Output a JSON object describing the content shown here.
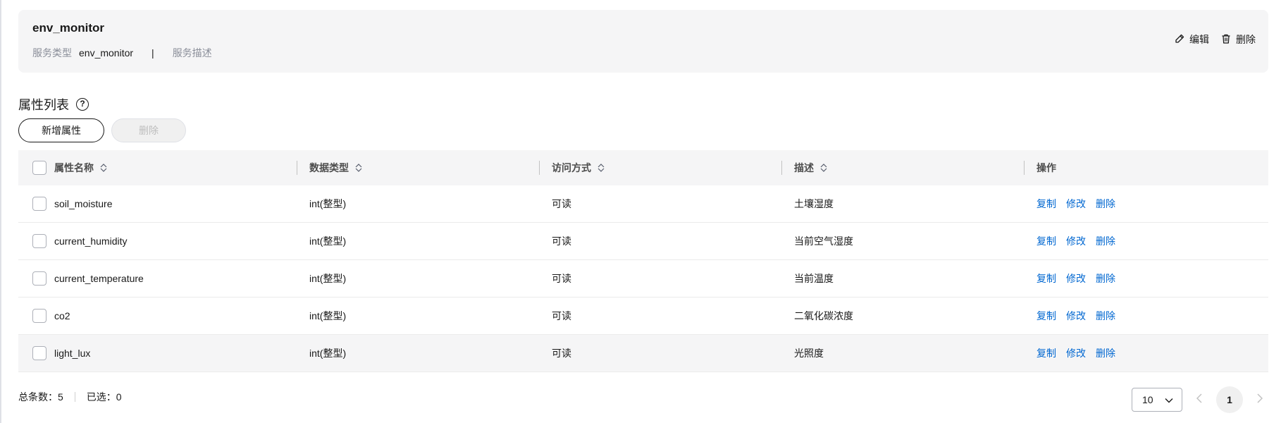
{
  "service": {
    "name": "env_monitor",
    "type_label": "服务类型",
    "type_value": "env_monitor",
    "separator": "|",
    "description_label": "服务描述",
    "edit_label": "编辑",
    "delete_label": "删除"
  },
  "section": {
    "title": "属性列表",
    "help_glyph": "?"
  },
  "toolbar": {
    "add_label": "新增属性",
    "delete_label": "删除"
  },
  "table": {
    "columns": [
      "属性名称",
      "数据类型",
      "访问方式",
      "描述",
      "操作"
    ],
    "rows": [
      {
        "name": "soil_moisture",
        "type": "int(整型)",
        "access": "可读",
        "desc": "土壤湿度"
      },
      {
        "name": "current_humidity",
        "type": "int(整型)",
        "access": "可读",
        "desc": "当前空气湿度"
      },
      {
        "name": "current_temperature",
        "type": "int(整型)",
        "access": "可读",
        "desc": "当前温度"
      },
      {
        "name": "co2",
        "type": "int(整型)",
        "access": "可读",
        "desc": "二氧化碳浓度"
      },
      {
        "name": "light_lux",
        "type": "int(整型)",
        "access": "可读",
        "desc": "光照度"
      }
    ],
    "ops": {
      "copy": "复制",
      "modify": "修改",
      "delete": "删除"
    }
  },
  "footer": {
    "total_text": "总条数：5",
    "selected_text": "已选：0"
  },
  "pagination": {
    "page_size": "10",
    "current_page": "1"
  },
  "colors": {
    "link": "#0067d1",
    "card_bg": "#f5f5f6",
    "text": "#191919"
  }
}
